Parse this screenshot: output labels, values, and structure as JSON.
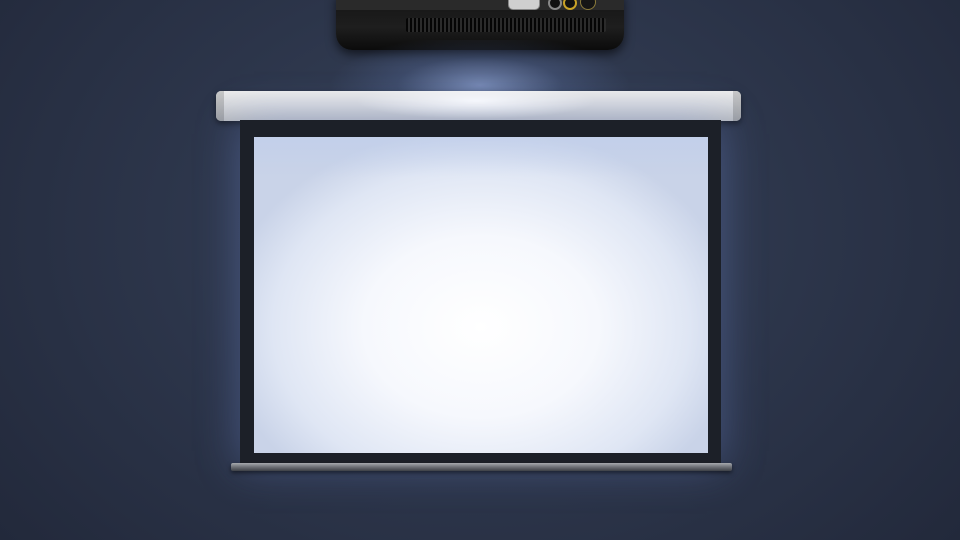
{
  "scene": {
    "description_label": "",
    "colors": {
      "wall": "#2c354a",
      "projector_body": "#1a1a1a",
      "housing": "#d6d8dc",
      "screen_frame": "#1c2028",
      "screen_surface": "#ffffff",
      "light_glow": "#aac3ff"
    },
    "icons": {
      "projector": "projector-icon",
      "vga_port": "vga-port-icon",
      "audio_jack": "audio-jack-icon",
      "power_button": "power-button-icon"
    }
  }
}
